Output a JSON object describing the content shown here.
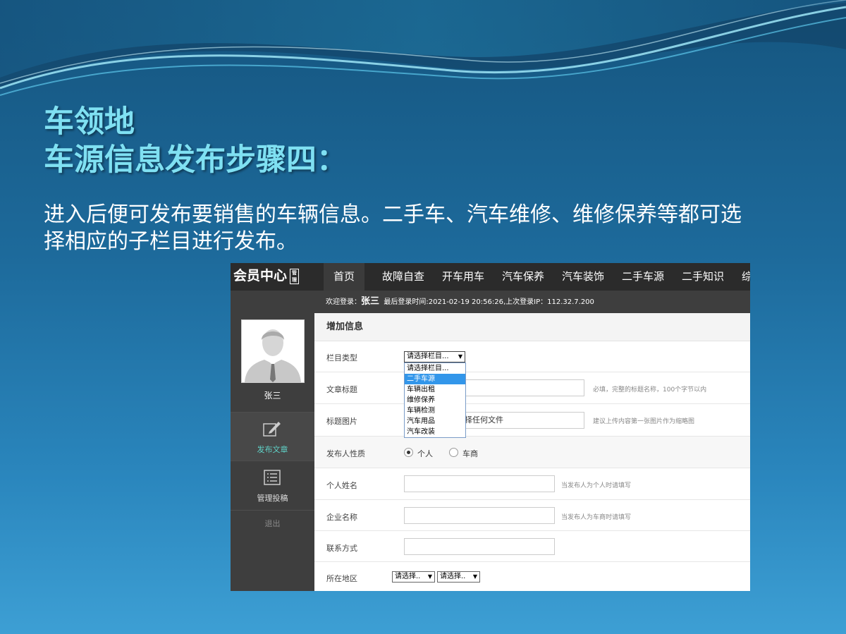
{
  "slide": {
    "title_line1": "车领地",
    "title_line2": "车源信息发布步骤四：",
    "description": "进入后便可发布要销售的车辆信息。二手车、汽车维修、维修保养等都可选择相应的子栏目进行发布。"
  },
  "site": {
    "brand": "会员中心",
    "brand_badge": "管理",
    "nav": [
      "首页",
      "故障自查",
      "开车用车",
      "汽车保养",
      "汽车装饰",
      "二手车源",
      "二手知识",
      "综"
    ],
    "welcome_prefix": "欢迎登录：",
    "user_name": "张三",
    "login_info": "最后登录时间:2021-02-19 20:56:26,上次登录IP：112.32.7.200"
  },
  "sidebar": {
    "name": "张三",
    "items": [
      "发布文章",
      "管理投稿",
      "退出"
    ]
  },
  "form": {
    "title": "增加信息",
    "category_label": "栏目类型",
    "category_selected": "请选择栏目...",
    "category_options": [
      "请选择栏目...",
      "二手车源",
      "车辆出租",
      "维修保养",
      "车辆检测",
      "汽车用品",
      "汽车改装"
    ],
    "article_title_label": "文章标题",
    "article_title_hint": "必填，完整的标题名称，100个字节以内",
    "image_label": "标题图片",
    "image_button_text": "择任何文件",
    "image_hint": "建议上传内容第一张图片作为缩略图",
    "publisher_type_label": "发布人性质",
    "publisher_options": [
      "个人",
      "车商"
    ],
    "publisher_selected": "个人",
    "person_name_label": "个人姓名",
    "person_name_hint": "当发布人为个人时请填写",
    "company_label": "企业名称",
    "company_hint": "当发布人为车商时请填写",
    "contact_label": "联系方式",
    "region_label": "所在地区",
    "region_select1": "请选择..",
    "region_select2": "请选择.."
  }
}
